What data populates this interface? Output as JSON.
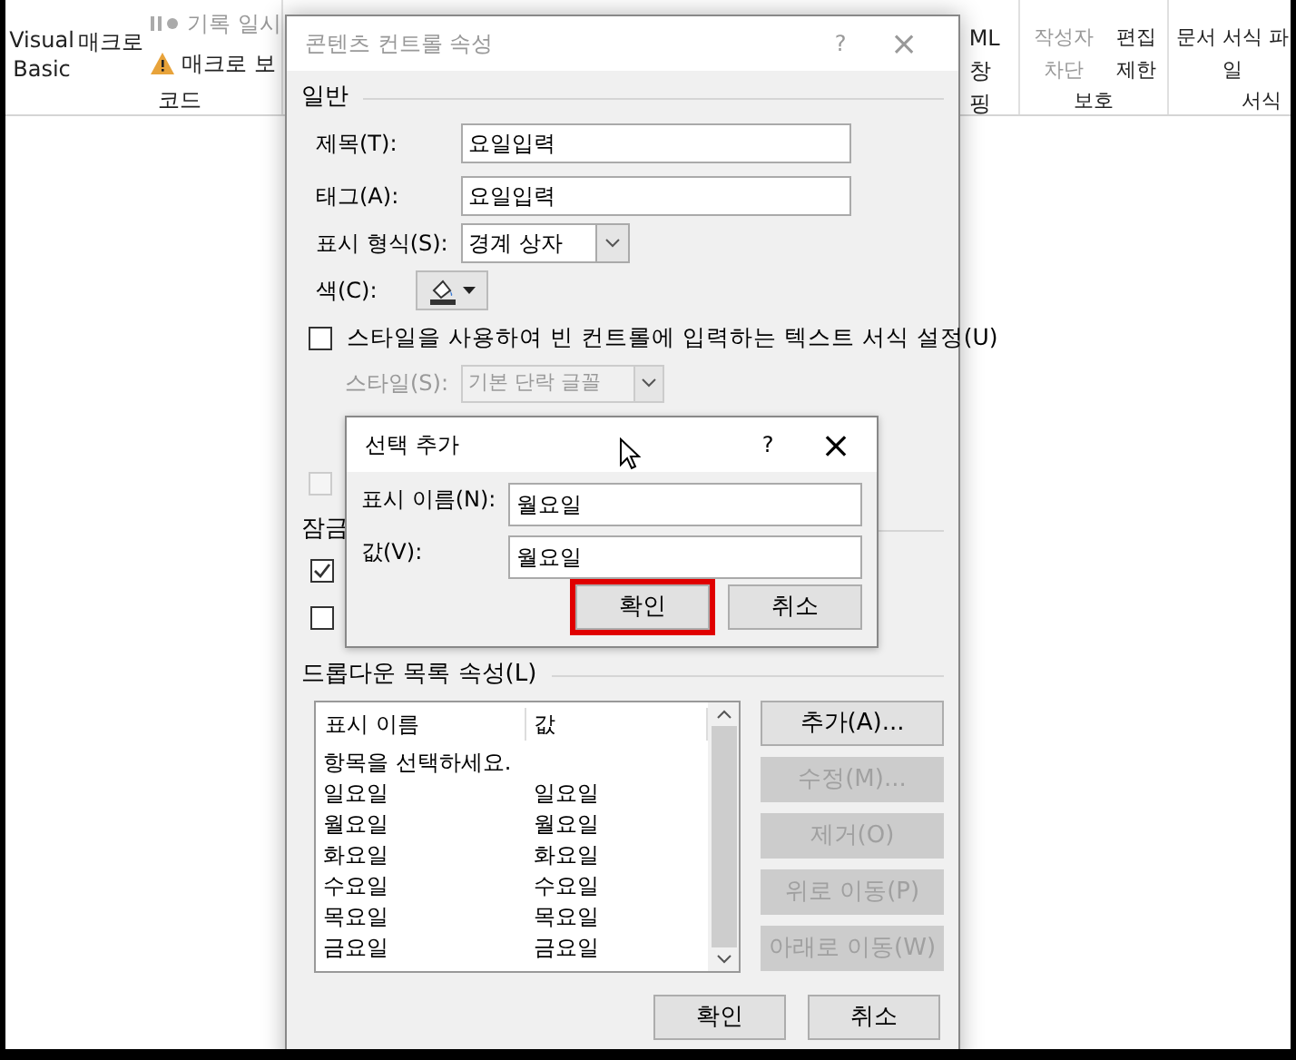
{
  "ribbon": {
    "groups": [
      {
        "name": "코드",
        "items": [
          "Visual Basic",
          "매크로"
        ],
        "small": [
          "기록 일시",
          "매크로 보"
        ]
      },
      {
        "name": "핑",
        "items": [
          "ML 창"
        ]
      },
      {
        "name": "보호",
        "items": [
          "작성자 차단",
          "편집 제한"
        ]
      },
      {
        "name": "서식",
        "items": [
          "문서 서식 파일"
        ]
      }
    ]
  },
  "dialog": {
    "title": "콘텐츠 컨트롤 속성",
    "help": "?",
    "close": "×",
    "general": {
      "heading": "일반",
      "title_field": {
        "label": "제목(T):",
        "value": "요일입력"
      },
      "tag_field": {
        "label": "태그(A):",
        "value": "요일입력"
      },
      "appearance": {
        "label": "표시 형식(S):",
        "value": "경계 상자"
      },
      "color": {
        "label": "색(C):"
      },
      "use_style": {
        "label": "스타일을 사용하여 빈 컨트롤에 입력하는 텍스트 서식 설정(U)",
        "checked": false
      },
      "style": {
        "label": "스타일(S):",
        "value": "기본 단락 글꼴",
        "disabled": true
      },
      "extra_checkbox": {
        "checked": false,
        "disabled": true
      }
    },
    "locking": {
      "heading": "잠금",
      "checkboxes": [
        {
          "checked": true
        },
        {
          "checked": false
        }
      ]
    },
    "dropdown": {
      "heading": "드롭다운 목록 속성(L)",
      "columns": [
        "표시 이름",
        "값"
      ],
      "rows": [
        [
          "항목을 선택하세요.",
          ""
        ],
        [
          "일요일",
          "일요일"
        ],
        [
          "월요일",
          "월요일"
        ],
        [
          "화요일",
          "화요일"
        ],
        [
          "수요일",
          "수요일"
        ],
        [
          "목요일",
          "목요일"
        ],
        [
          "금요일",
          "금요일"
        ]
      ],
      "buttons": [
        {
          "label": "추가(A)...",
          "disabled": false
        },
        {
          "label": "수정(M)...",
          "disabled": true
        },
        {
          "label": "제거(O)",
          "disabled": true
        },
        {
          "label": "위로 이동(P)",
          "disabled": true
        },
        {
          "label": "아래로 이동(W)",
          "disabled": true
        }
      ]
    },
    "ok": "확인",
    "cancel": "취소"
  },
  "add_dialog": {
    "title": "선택 추가",
    "help": "?",
    "close": "×",
    "display_name": {
      "label": "표시 이름(N):",
      "value": "월요일"
    },
    "value": {
      "label": "값(V):",
      "value": "월요일"
    },
    "ok": {
      "label": "확인",
      "highlighted": true
    },
    "cancel": {
      "label": "취소",
      "highlighted": false
    }
  }
}
